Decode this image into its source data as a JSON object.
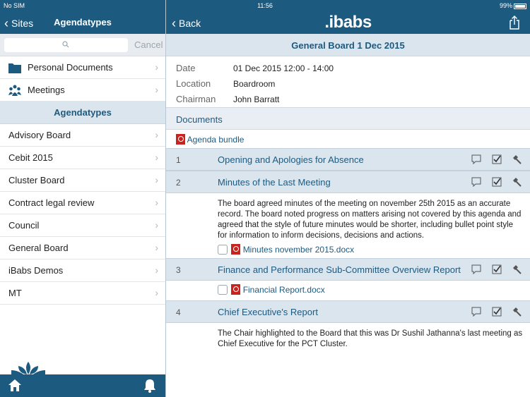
{
  "status_bar": {
    "carrier": "No SIM",
    "time": "11:56",
    "battery": "99%"
  },
  "left": {
    "nav": {
      "back_label": "Sites",
      "title": "Agendatypes"
    },
    "search": {
      "placeholder": "",
      "cancel_label": "Cancel"
    },
    "top_items": [
      {
        "label": "Personal Documents",
        "icon": "folder-icon"
      },
      {
        "label": "Meetings",
        "icon": "people-icon"
      }
    ],
    "section_title": "Agendatypes",
    "agendatypes": [
      "Advisory Board",
      "Cebit 2015",
      "Cluster Board",
      "Contract legal review",
      "Council",
      "General Board",
      "iBabs Demos",
      "MT"
    ]
  },
  "right": {
    "nav": {
      "back_label": "Back",
      "logo": "ibabs"
    },
    "meeting_title": "General Board 1 Dec 2015",
    "info": [
      {
        "key": "Date",
        "value": "01 Dec 2015 12:00 - 14:00"
      },
      {
        "key": "Location",
        "value": "Boardroom"
      },
      {
        "key": "Chairman",
        "value": "John Barratt"
      }
    ],
    "documents_label": "Documents",
    "bundle_label": "Agenda bundle",
    "items": [
      {
        "num": "1",
        "title": "Opening and Apologies for Absence",
        "notes": "",
        "attachment": ""
      },
      {
        "num": "2",
        "title": "Minutes of the Last Meeting",
        "notes": "The board agreed minutes of the meeting on november 25th 2015 as an accurate record. The board noted progress on matters arising not covered by this agenda and agreed that the style of future minutes would be shorter, including bullet point style for information to inform decisions, decisions and actions.",
        "attachment": "Minutes november 2015.docx"
      },
      {
        "num": "3",
        "title": "Finance and Performance Sub-Committee Overview Report",
        "notes": "",
        "attachment": "Financial Report.docx"
      },
      {
        "num": "4",
        "title": "Chief Executive's Report",
        "notes": "The Chair highlighted to the Board that this was Dr Sushil Jathanna's last meeting as Chief Executive for the PCT Cluster.",
        "attachment": ""
      }
    ]
  },
  "colors": {
    "brand": "#1d5a80",
    "section_bg": "#dbe5ee",
    "pdf_red": "#c8231e"
  }
}
